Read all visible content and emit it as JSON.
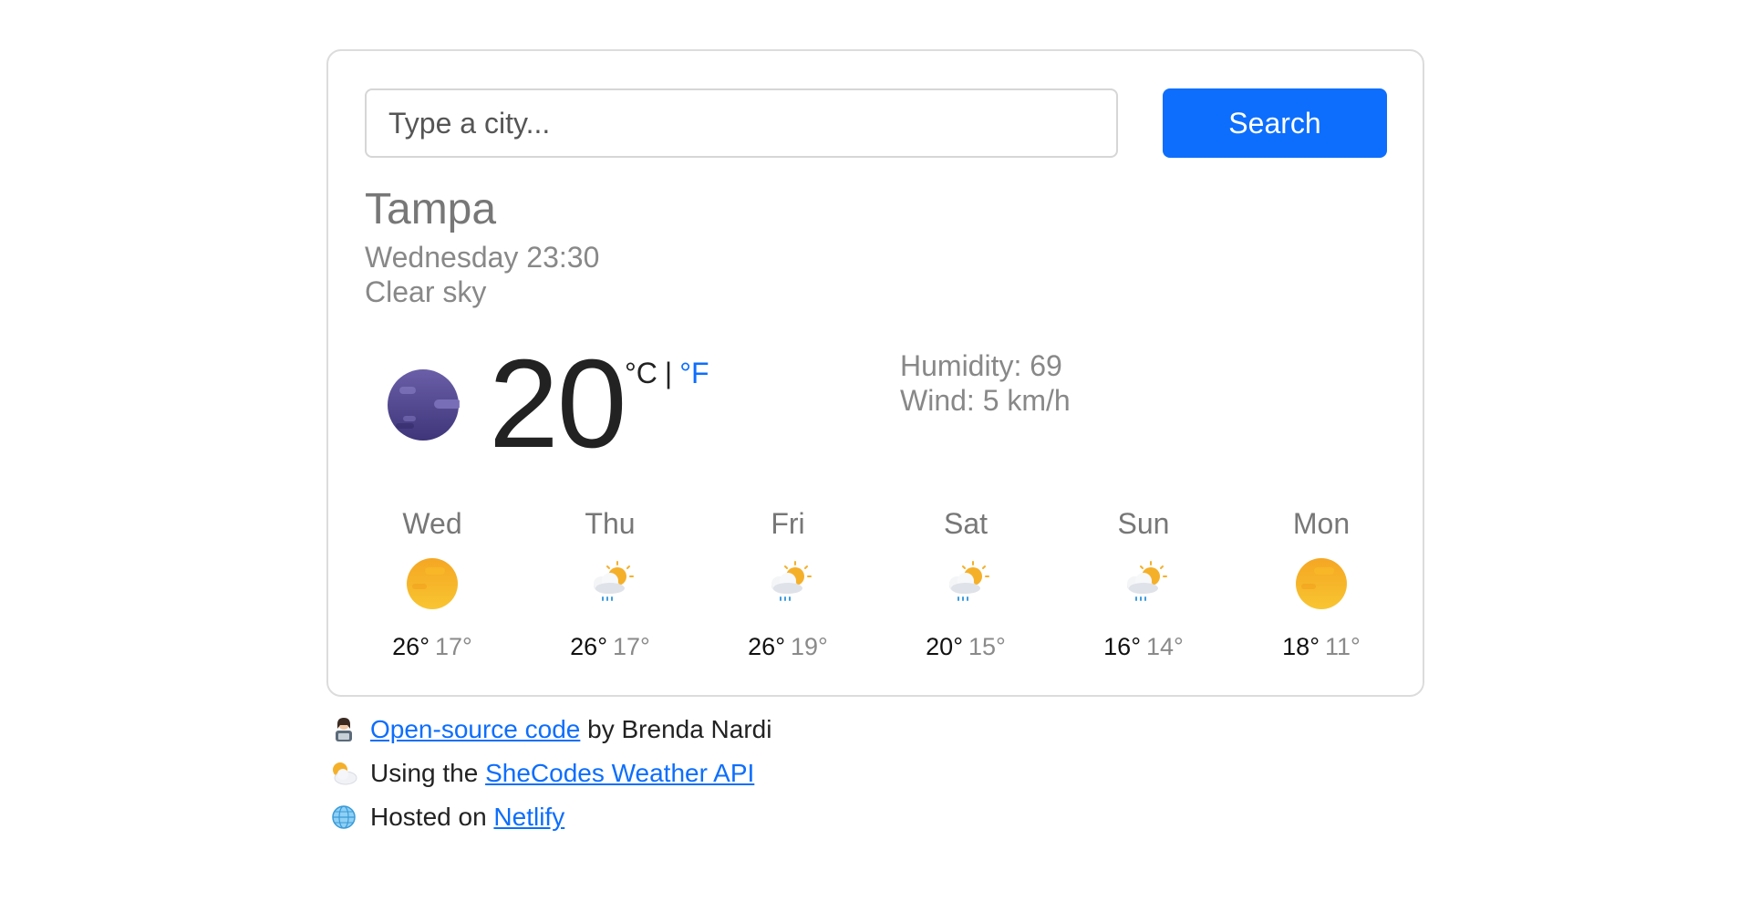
{
  "search": {
    "placeholder": "Type a city...",
    "button_label": "Search"
  },
  "current": {
    "city": "Tampa",
    "datetime": "Wednesday 23:30",
    "description": "Clear sky",
    "icon": "clear-night-moon-icon",
    "temperature": "20",
    "unit_celsius": "°C",
    "unit_separator": "|",
    "unit_fahrenheit": "°F",
    "humidity": "Humidity: 69",
    "wind": "Wind: 5 km/h"
  },
  "forecast": [
    {
      "day": "Wed",
      "icon": "sun-icon",
      "max": "26°",
      "min": "17°"
    },
    {
      "day": "Thu",
      "icon": "rain-sun-cloud-icon",
      "max": "26°",
      "min": "17°"
    },
    {
      "day": "Fri",
      "icon": "rain-sun-cloud-icon",
      "max": "26°",
      "min": "19°"
    },
    {
      "day": "Sat",
      "icon": "rain-sun-cloud-icon",
      "max": "20°",
      "min": "15°"
    },
    {
      "day": "Sun",
      "icon": "rain-sun-cloud-icon",
      "max": "16°",
      "min": "14°"
    },
    {
      "day": "Mon",
      "icon": "sun-icon",
      "max": "18°",
      "min": "11°"
    }
  ],
  "footer": {
    "line1": {
      "link": "Open-source code",
      "text": " by Brenda Nardi",
      "icon": "woman-technologist-icon"
    },
    "line2": {
      "text": "Using the ",
      "link": "SheCodes Weather API",
      "icon": "sun-behind-cloud-icon"
    },
    "line3": {
      "text": "Hosted on ",
      "link": "Netlify",
      "icon": "globe-icon"
    }
  },
  "colors": {
    "accent": "#0d6efd",
    "card_border": "#dcdcdc",
    "muted_text": "#888888"
  }
}
